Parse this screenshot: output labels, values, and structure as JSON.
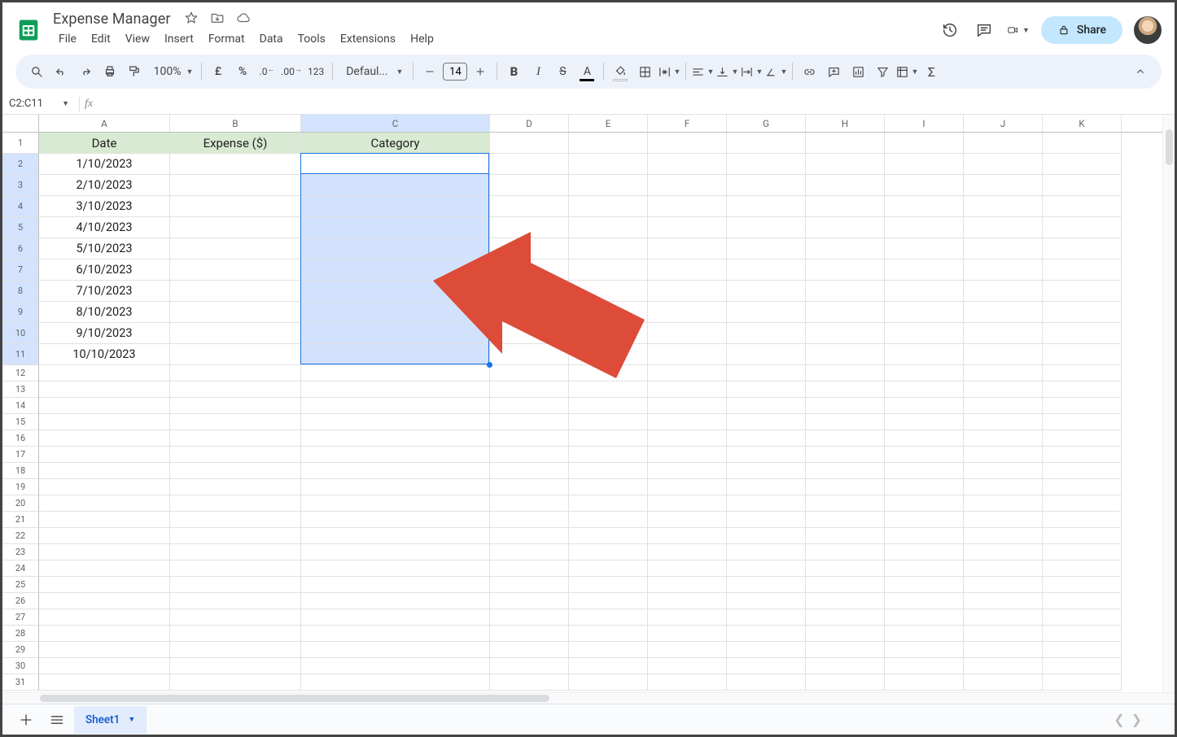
{
  "doc": {
    "title": "Expense Manager"
  },
  "menus": [
    "File",
    "Edit",
    "View",
    "Insert",
    "Format",
    "Data",
    "Tools",
    "Extensions",
    "Help"
  ],
  "share": {
    "label": "Share"
  },
  "toolbar": {
    "zoom": "100%",
    "font": "Defaul...",
    "fontSize": "14",
    "numfmt": "123"
  },
  "namebox": {
    "range": "C2:C11"
  },
  "columns": [
    "A",
    "B",
    "C",
    "D",
    "E",
    "F",
    "G",
    "H",
    "I",
    "J",
    "K"
  ],
  "headers": {
    "A": "Date",
    "B": "Expense ($)",
    "C": "Category"
  },
  "dates": [
    "1/10/2023",
    "2/10/2023",
    "3/10/2023",
    "4/10/2023",
    "5/10/2023",
    "6/10/2023",
    "7/10/2023",
    "8/10/2023",
    "9/10/2023",
    "10/10/2023"
  ],
  "selection": {
    "text": "C2:C11"
  },
  "totalRowsShown": 31,
  "sheet": {
    "name": "Sheet1"
  }
}
